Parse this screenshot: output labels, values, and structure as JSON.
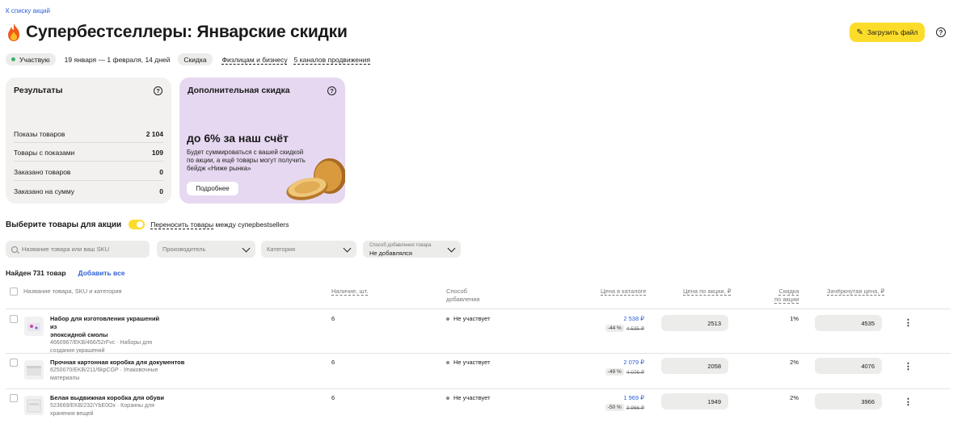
{
  "back_link": "К списку акций",
  "title": "Супербестселлеры: Январские скидки",
  "upload_button": "Загрузить файл",
  "status": "Участвую",
  "dates": "19 января — 1 февраля, 14 дней",
  "type_chip": "Скидка",
  "audience_link": "Физлицам и бизнесу",
  "channels_link": "5 каналов продвижения",
  "results": {
    "title": "Результаты",
    "stats": [
      {
        "label": "Показы товаров",
        "value": "2 104"
      },
      {
        "label": "Товары с показами",
        "value": "109"
      },
      {
        "label": "Заказано товаров",
        "value": "0"
      },
      {
        "label": "Заказано на сумму",
        "value": "0"
      }
    ]
  },
  "extra_discount": {
    "title": "Дополнительная скидка",
    "headline": "до 6% за наш счёт",
    "description": "Будет суммироваться с вашей скидкой по акции, а ещё товары могут получить бейдж «Ниже рынка»",
    "button": "Подробнее"
  },
  "select_section": {
    "title": "Выберите товары для акции",
    "move_link": "Переносить товары",
    "move_rest": " между суперbegestsellers"
  },
  "filters": {
    "search_placeholder": "Название товара или ваш SKU",
    "manufacturer": "Производитель",
    "category": "Категория",
    "add_method_label": "Способ добавления товара",
    "add_method_value": "Не добавлялся"
  },
  "found": "Найден 731 товар",
  "add_all": "Добавить все",
  "columns": {
    "name": "Название товара, SKU и категория",
    "stock": "Наличие, шт.",
    "method_1": "Способ",
    "method_2": "добавления",
    "catalog_price": "Цена в каталоге",
    "promo_price": "Цена по акции, ₽",
    "discount_1": "Скидка",
    "discount_2": "по акции",
    "strike_price": "Зачёркнутая цена, ₽"
  },
  "rows": [
    {
      "name_1": "Набор для изготовления украшений из",
      "name_2": "эпоксидной смолы",
      "sub_1": "4660967/EKB/466/52rFvc · Наборы для",
      "sub_2": "создания украшений",
      "stock": "6",
      "method": "Не участвует",
      "price": "2 538 ₽",
      "badge": "-44 %",
      "old_price": "4 535 ₽",
      "promo": "2513",
      "discount": "1%",
      "strike": "4535"
    },
    {
      "name_1": "Прочная картонная коробка для документов",
      "name_2": "",
      "sub_1": "6250070/EKB/211/6kpCGP · Упаковочные",
      "sub_2": "материалы",
      "stock": "6",
      "method": "Не участвует",
      "price": "2 079 ₽",
      "badge": "-49 %",
      "old_price": "4 076 ₽",
      "promo": "2058",
      "discount": "2%",
      "strike": "4076"
    },
    {
      "name_1": "Белая выдвижная коробка для обуви",
      "name_2": "",
      "sub_1": "523669/EKB/232/YbE0Ox · Корзины для",
      "sub_2": "хранения вещей",
      "stock": "6",
      "method": "Не участвует",
      "price": "1 969 ₽",
      "badge": "-50 %",
      "old_price": "3 966 ₽",
      "promo": "1949",
      "discount": "2%",
      "strike": "3966"
    }
  ]
}
